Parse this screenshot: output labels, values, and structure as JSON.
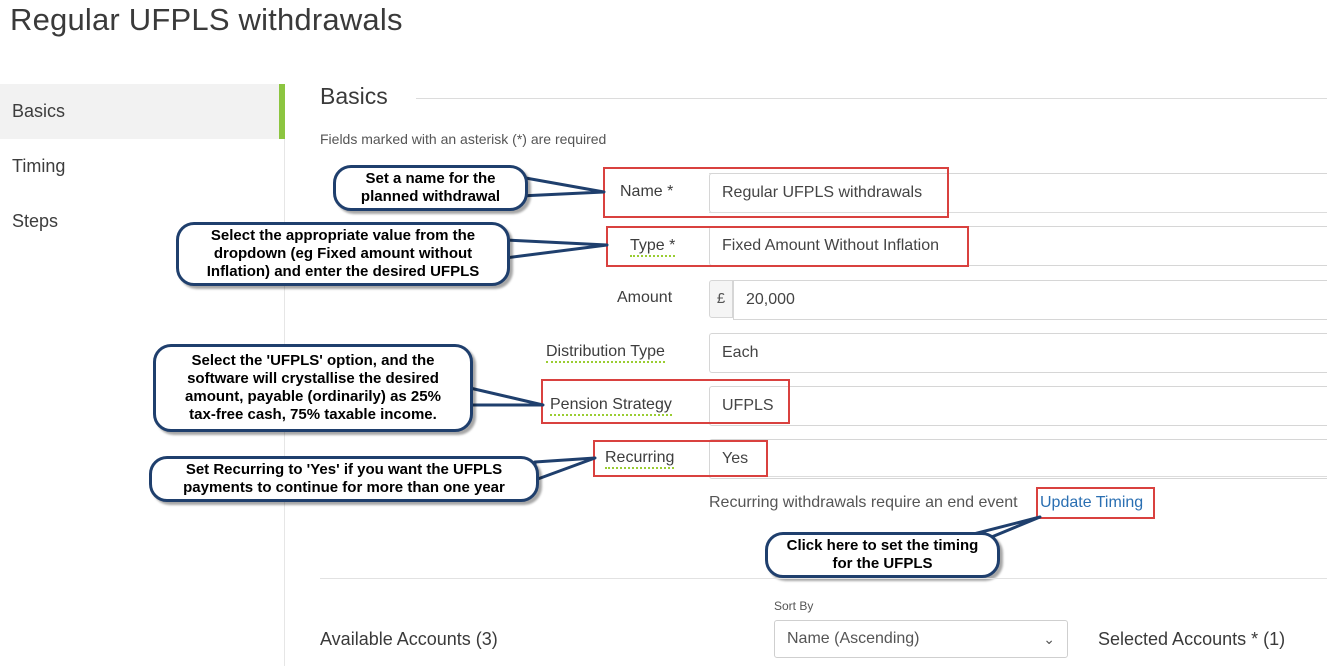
{
  "page": {
    "title": "Regular UFPLS withdrawals"
  },
  "sidebar": {
    "items": [
      {
        "label": "Basics"
      },
      {
        "label": "Timing"
      },
      {
        "label": "Steps"
      }
    ]
  },
  "section": {
    "title": "Basics",
    "required_note": "Fields marked with an asterisk (*) are required"
  },
  "form": {
    "name": {
      "label": "Name *",
      "value": "Regular UFPLS withdrawals"
    },
    "type": {
      "label": "Type *",
      "value": "Fixed Amount Without Inflation"
    },
    "amount": {
      "label": "Amount",
      "currency": "£",
      "value": "20,000"
    },
    "distribution_type": {
      "label": "Distribution Type",
      "value": "Each"
    },
    "pension_strategy": {
      "label": "Pension Strategy",
      "value": "UFPLS"
    },
    "recurring": {
      "label": "Recurring",
      "value": "Yes"
    },
    "timing_note": "Recurring withdrawals require an end event",
    "timing_link": "Update Timing"
  },
  "accounts": {
    "sort_label": "Sort By",
    "sort_value": "Name (Ascending)",
    "available": "Available Accounts (3)",
    "selected": "Selected Accounts * (1)"
  },
  "callouts": {
    "name": [
      "Set a name for the",
      "planned withdrawal"
    ],
    "type": [
      "Select the appropriate value from the",
      "dropdown (eg Fixed amount without",
      "Inflation) and enter the desired UFPLS"
    ],
    "pension": [
      "Select the 'UFPLS' option, and the",
      "software will crystallise the desired",
      "amount, payable (ordinarily) as 25%",
      "tax-free cash, 75% taxable income."
    ],
    "recurring": [
      "Set Recurring to 'Yes' if you want the UFPLS",
      "payments to continue for more than one year"
    ],
    "timing": [
      "Click here to set the timing",
      "for the UFPLS"
    ]
  },
  "colors": {
    "accent_green": "#8cc540",
    "highlight_red": "#d9413f",
    "callout_border": "#1f3f6d",
    "link_blue": "#2a6fb2"
  }
}
